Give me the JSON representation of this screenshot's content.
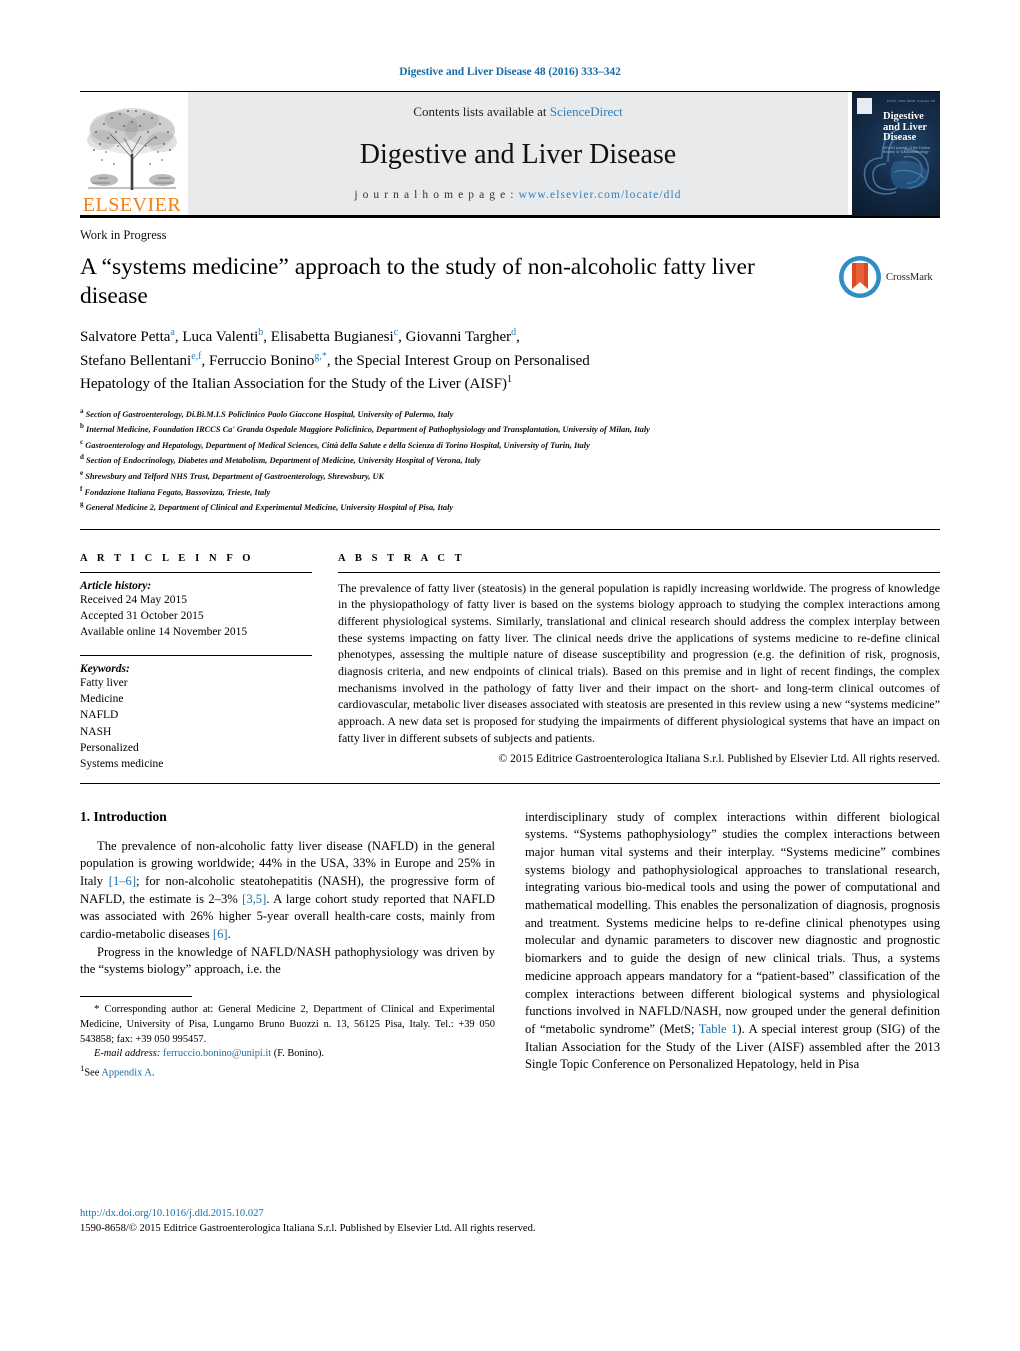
{
  "running_head": "Digestive and Liver Disease 48 (2016) 333–342",
  "masthead": {
    "contents_prefix": "Contents lists available at ",
    "sciencedirect": "ScienceDirect",
    "journal_title": "Digestive and Liver Disease",
    "homepage_label": "j o u r n a l   h o m e p a g e :  ",
    "homepage_url": "www.elsevier.com/locate/dld",
    "publisher_wordmark": "ELSEVIER",
    "cover_title_line1": "Digestive",
    "cover_title_line2": "and Liver",
    "cover_title_line3": "Disease",
    "cover_subtitle": "official journal of the Italian Society of Gastroenterology",
    "cover_topline": "ISSN 1590-8658  Volume 48",
    "accent_link_color": "#2f7fba",
    "elsevier_orange": "#F07F1A"
  },
  "article": {
    "kicker": "Work in Progress",
    "title": "A “systems medicine” approach to the study of non-alcoholic fatty liver disease",
    "crossmark_label": "CrossMark",
    "authors_html": "Salvatore Petta<sup>a</sup>, Luca Valenti<sup>b</sup>, Elisabetta Bugianesi<sup>c</sup>, Giovanni Targher<sup>d</sup>,<br>Stefano Bellentani<sup>e,f</sup>, Ferruccio Bonino<sup>g,*</sup>, the Special Interest Group on Personalised<br>Hepatology of the Italian Association for the Study of the Liver (AISF)<sup class=\"black\">1</sup>",
    "affiliations": [
      {
        "marker": "a",
        "text": "Section of Gastroenterology, Di.Bi.M.I.S Policlinico Paolo Giaccone Hospital, University of Palermo, Italy"
      },
      {
        "marker": "b",
        "text": "Internal Medicine, Foundation IRCCS Ca' Granda Ospedale Maggiore Policlinico, Department of Pathophysiology and Transplantation, University of Milan, Italy"
      },
      {
        "marker": "c",
        "text": "Gastroenterology and Hepatology, Department of Medical Sciences, Città della Salute e della Scienza di Torino Hospital, University of Turin, Italy"
      },
      {
        "marker": "d",
        "text": "Section of Endocrinology, Diabetes and Metabolism, Department of Medicine, University Hospital of Verona, Italy"
      },
      {
        "marker": "e",
        "text": "Shrewsbury and Telford NHS Trust, Department of Gastroenterology, Shrewsbury, UK"
      },
      {
        "marker": "f",
        "text": "Fondazione Italiana Fegato, Bassovizza, Trieste, Italy"
      },
      {
        "marker": "g",
        "text": "General Medicine 2, Department of Clinical and Experimental Medicine, University Hospital of Pisa, Italy"
      }
    ]
  },
  "article_info": {
    "heading": "A R T I C L E   I N F O",
    "history_label": "Article history:",
    "history": [
      "Received 24 May 2015",
      "Accepted 31 October 2015",
      "Available online 14 November 2015"
    ],
    "keywords_label": "Keywords:",
    "keywords": [
      "Fatty liver",
      "Medicine",
      "NAFLD",
      "NASH",
      "Personalized",
      "Systems medicine"
    ]
  },
  "abstract": {
    "heading": "A B S T R A C T",
    "text": "The prevalence of fatty liver (steatosis) in the general population is rapidly increasing worldwide. The progress of knowledge in the physiopathology of fatty liver is based on the systems biology approach to studying the complex interactions among different physiological systems. Similarly, translational and clinical research should address the complex interplay between these systems impacting on fatty liver. The clinical needs drive the applications of systems medicine to re-define clinical phenotypes, assessing the multiple nature of disease susceptibility and progression (e.g. the definition of risk, prognosis, diagnosis criteria, and new endpoints of clinical trials). Based on this premise and in light of recent findings, the complex mechanisms involved in the pathology of fatty liver and their impact on the short- and long-term clinical outcomes of cardiovascular, metabolic liver diseases associated with steatosis are presented in this review using a new “systems medicine” approach. A new data set is proposed for studying the impairments of different physiological systems that have an impact on fatty liver in different subsets of subjects and patients.",
    "copyright": "© 2015 Editrice Gastroenterologica Italiana S.r.l. Published by Elsevier Ltd. All rights reserved."
  },
  "body": {
    "section_heading": "1. Introduction",
    "left_paragraph_1_html": "The prevalence of non-alcoholic fatty liver disease (NAFLD) in the general population is growing worldwide; 44% in the USA, 33% in Europe and 25% in Italy <span class=\"ref\">[1–6]</span>; for non-alcoholic steatohepatitis (NASH), the progressive form of NAFLD, the estimate is 2–3% <span class=\"ref\">[3,5]</span>. A large cohort study reported that NAFLD was associated with 26% higher 5-year overall health-care costs, mainly from cardio-metabolic diseases <span class=\"ref\">[6]</span>.",
    "left_paragraph_2_html": "Progress in the knowledge of NAFLD/NASH pathophysiology was driven by the “systems biology” approach, i.e. the",
    "right_paragraph_1_html": "interdisciplinary study of complex interactions within different biological systems. “Systems pathophysiology” studies the complex interactions between major human vital systems and their interplay. “Systems medicine” combines systems biology and pathophysiological approaches to translational research, integrating various bio-medical tools and using the power of computational and mathematical modelling. This enables the personalization of diagnosis, prognosis and treatment. Systems medicine helps to re-define clinical phenotypes using molecular and dynamic parameters to discover new diagnostic and prognostic biomarkers and to guide the design of new clinical trials. Thus, a systems medicine approach appears mandatory for a “patient-based” classification of the complex interactions between different biological systems and physiological functions involved in NAFLD/NASH, now grouped under the general definition of “metabolic syndrome” (MetS; <span class=\"ref\">Table 1</span>). A special interest group (SIG) of the Italian Association for the Study of the Liver (AISF) assembled after the 2013 Single Topic Conference on Personalized Hepatology, held in Pisa"
  },
  "footnote": {
    "corresponding_html": "<span style=\"font-size:11px\">*</span> Corresponding author at: General Medicine 2, Department of Clinical and Experimental Medicine, University of Pisa, Lungarno Bruno Buozzi n. 13, 56125 Pisa, Italy. Tel.: +39 050 543858; fax: +39 050 995457.",
    "email_label": "E-mail address:",
    "email": "ferruccio.bonino@unipi.it",
    "email_owner": "(F. Bonino).",
    "appendix_prefix": "1",
    "appendix_see": "See ",
    "appendix_link": "Appendix A",
    "appendix_suffix": "."
  },
  "page_footer": {
    "doi": "http://dx.doi.org/10.1016/j.dld.2015.10.027",
    "copyright": "1590-8658/© 2015 Editrice Gastroenterologica Italiana S.r.l. Published by Elsevier Ltd. All rights reserved."
  }
}
